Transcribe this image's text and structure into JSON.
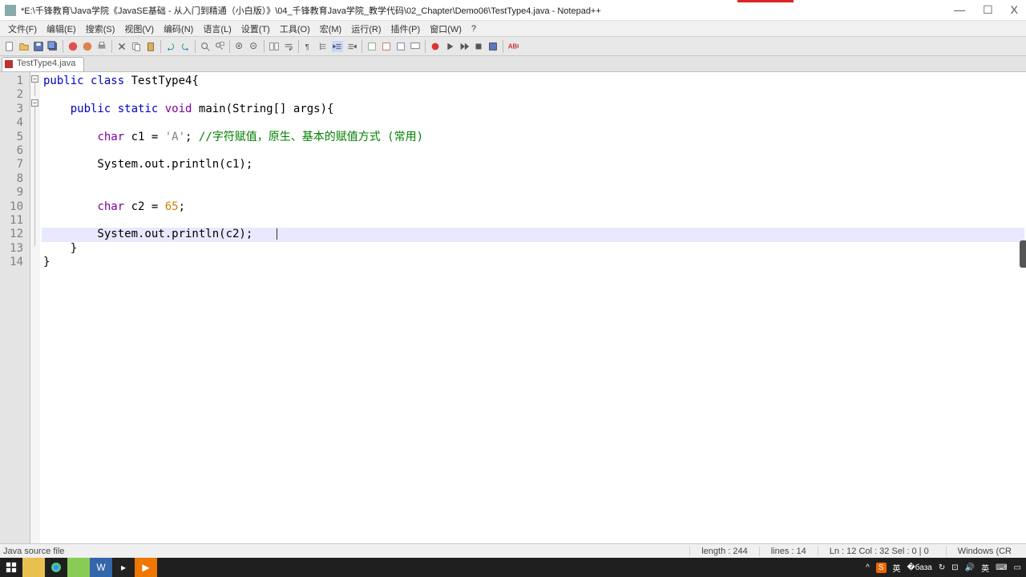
{
  "window": {
    "title": "*E:\\千锋教育\\Java学院《JavaSE基础 - 从入门到精通（小白版）》\\04_千锋教育Java学院_教学代码\\02_Chapter\\Demo06\\TestType4.java - Notepad++",
    "minimize": "—",
    "maximize": "☐",
    "close": "X"
  },
  "menu": {
    "items": [
      "文件(F)",
      "编辑(E)",
      "搜索(S)",
      "视图(V)",
      "编码(N)",
      "语言(L)",
      "设置(T)",
      "工具(O)",
      "宏(M)",
      "运行(R)",
      "插件(P)",
      "窗口(W)",
      "?"
    ]
  },
  "tab": {
    "label": "TestType4.java"
  },
  "code": {
    "lines": [
      {
        "n": 1,
        "html": "<span class='kw'>public</span> <span class='kw'>class</span> TestType4{"
      },
      {
        "n": 2,
        "html": ""
      },
      {
        "n": 3,
        "html": "    <span class='kw'>public</span> <span class='kw'>static</span> <span class='type'>void</span> main(String[] args){"
      },
      {
        "n": 4,
        "html": ""
      },
      {
        "n": 5,
        "html": "        <span class='type'>char</span> c1 = <span class='str'>'A'</span>; <span class='cmt'>//字符赋值，原生、基本的赋值方式 (常用)</span>"
      },
      {
        "n": 6,
        "html": ""
      },
      {
        "n": 7,
        "html": "        System.out.println(c1);"
      },
      {
        "n": 8,
        "html": ""
      },
      {
        "n": 9,
        "html": ""
      },
      {
        "n": 10,
        "html": "        <span class='type'>char</span> c2 = <span class='num'>65</span>;"
      },
      {
        "n": 11,
        "html": ""
      },
      {
        "n": 12,
        "html": "        System.out.println(c2);<span class='txtcur'></span>",
        "current": true
      },
      {
        "n": 13,
        "html": "    }"
      },
      {
        "n": 14,
        "html": "}"
      }
    ]
  },
  "status": {
    "filetype": "Java source file",
    "length": "length : 244",
    "lines": "lines : 14",
    "pos": "Ln : 12    Col : 32    Sel : 0 | 0",
    "os": "Windows (CR"
  },
  "tray": {
    "ime": "英",
    "dir": "英"
  }
}
